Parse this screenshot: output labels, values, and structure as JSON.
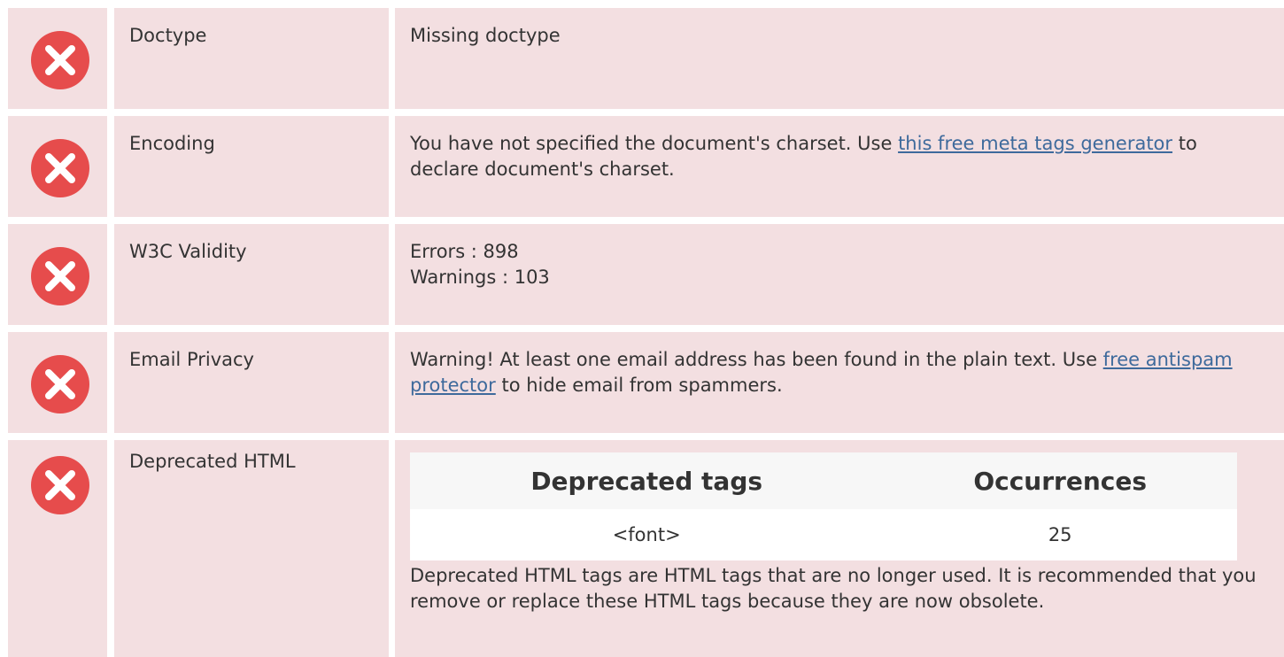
{
  "colors": {
    "row_background": "#f3dfe1",
    "error_icon": "#e64c4c",
    "link": "#3e6a9c"
  },
  "rows": [
    {
      "status_icon": "error-circle-x-icon",
      "label": "Doctype",
      "value": "Missing doctype"
    },
    {
      "status_icon": "error-circle-x-icon",
      "label": "Encoding",
      "value_prefix": "You have not specified the document's charset. Use ",
      "link_text": "this free meta tags generator",
      "value_suffix": " to declare document's charset."
    },
    {
      "status_icon": "error-circle-x-icon",
      "label": "W3C Validity",
      "errors": "Errors : 898",
      "warnings": "Warnings : 103"
    },
    {
      "status_icon": "error-circle-x-icon",
      "label": "Email Privacy",
      "value_prefix": "Warning! At least one email address has been found in the plain text. Use ",
      "link_text": "free antispam protector",
      "value_suffix": " to hide email from spammers."
    },
    {
      "status_icon": "error-circle-x-icon",
      "label": "Deprecated HTML",
      "table": {
        "headers": [
          "Deprecated tags",
          "Occurrences"
        ],
        "rows": [
          [
            "<font>",
            "25"
          ]
        ]
      },
      "note": "Deprecated HTML tags are HTML tags that are no longer used. It is recommended that you remove or replace these HTML tags because they are now obsolete."
    }
  ]
}
